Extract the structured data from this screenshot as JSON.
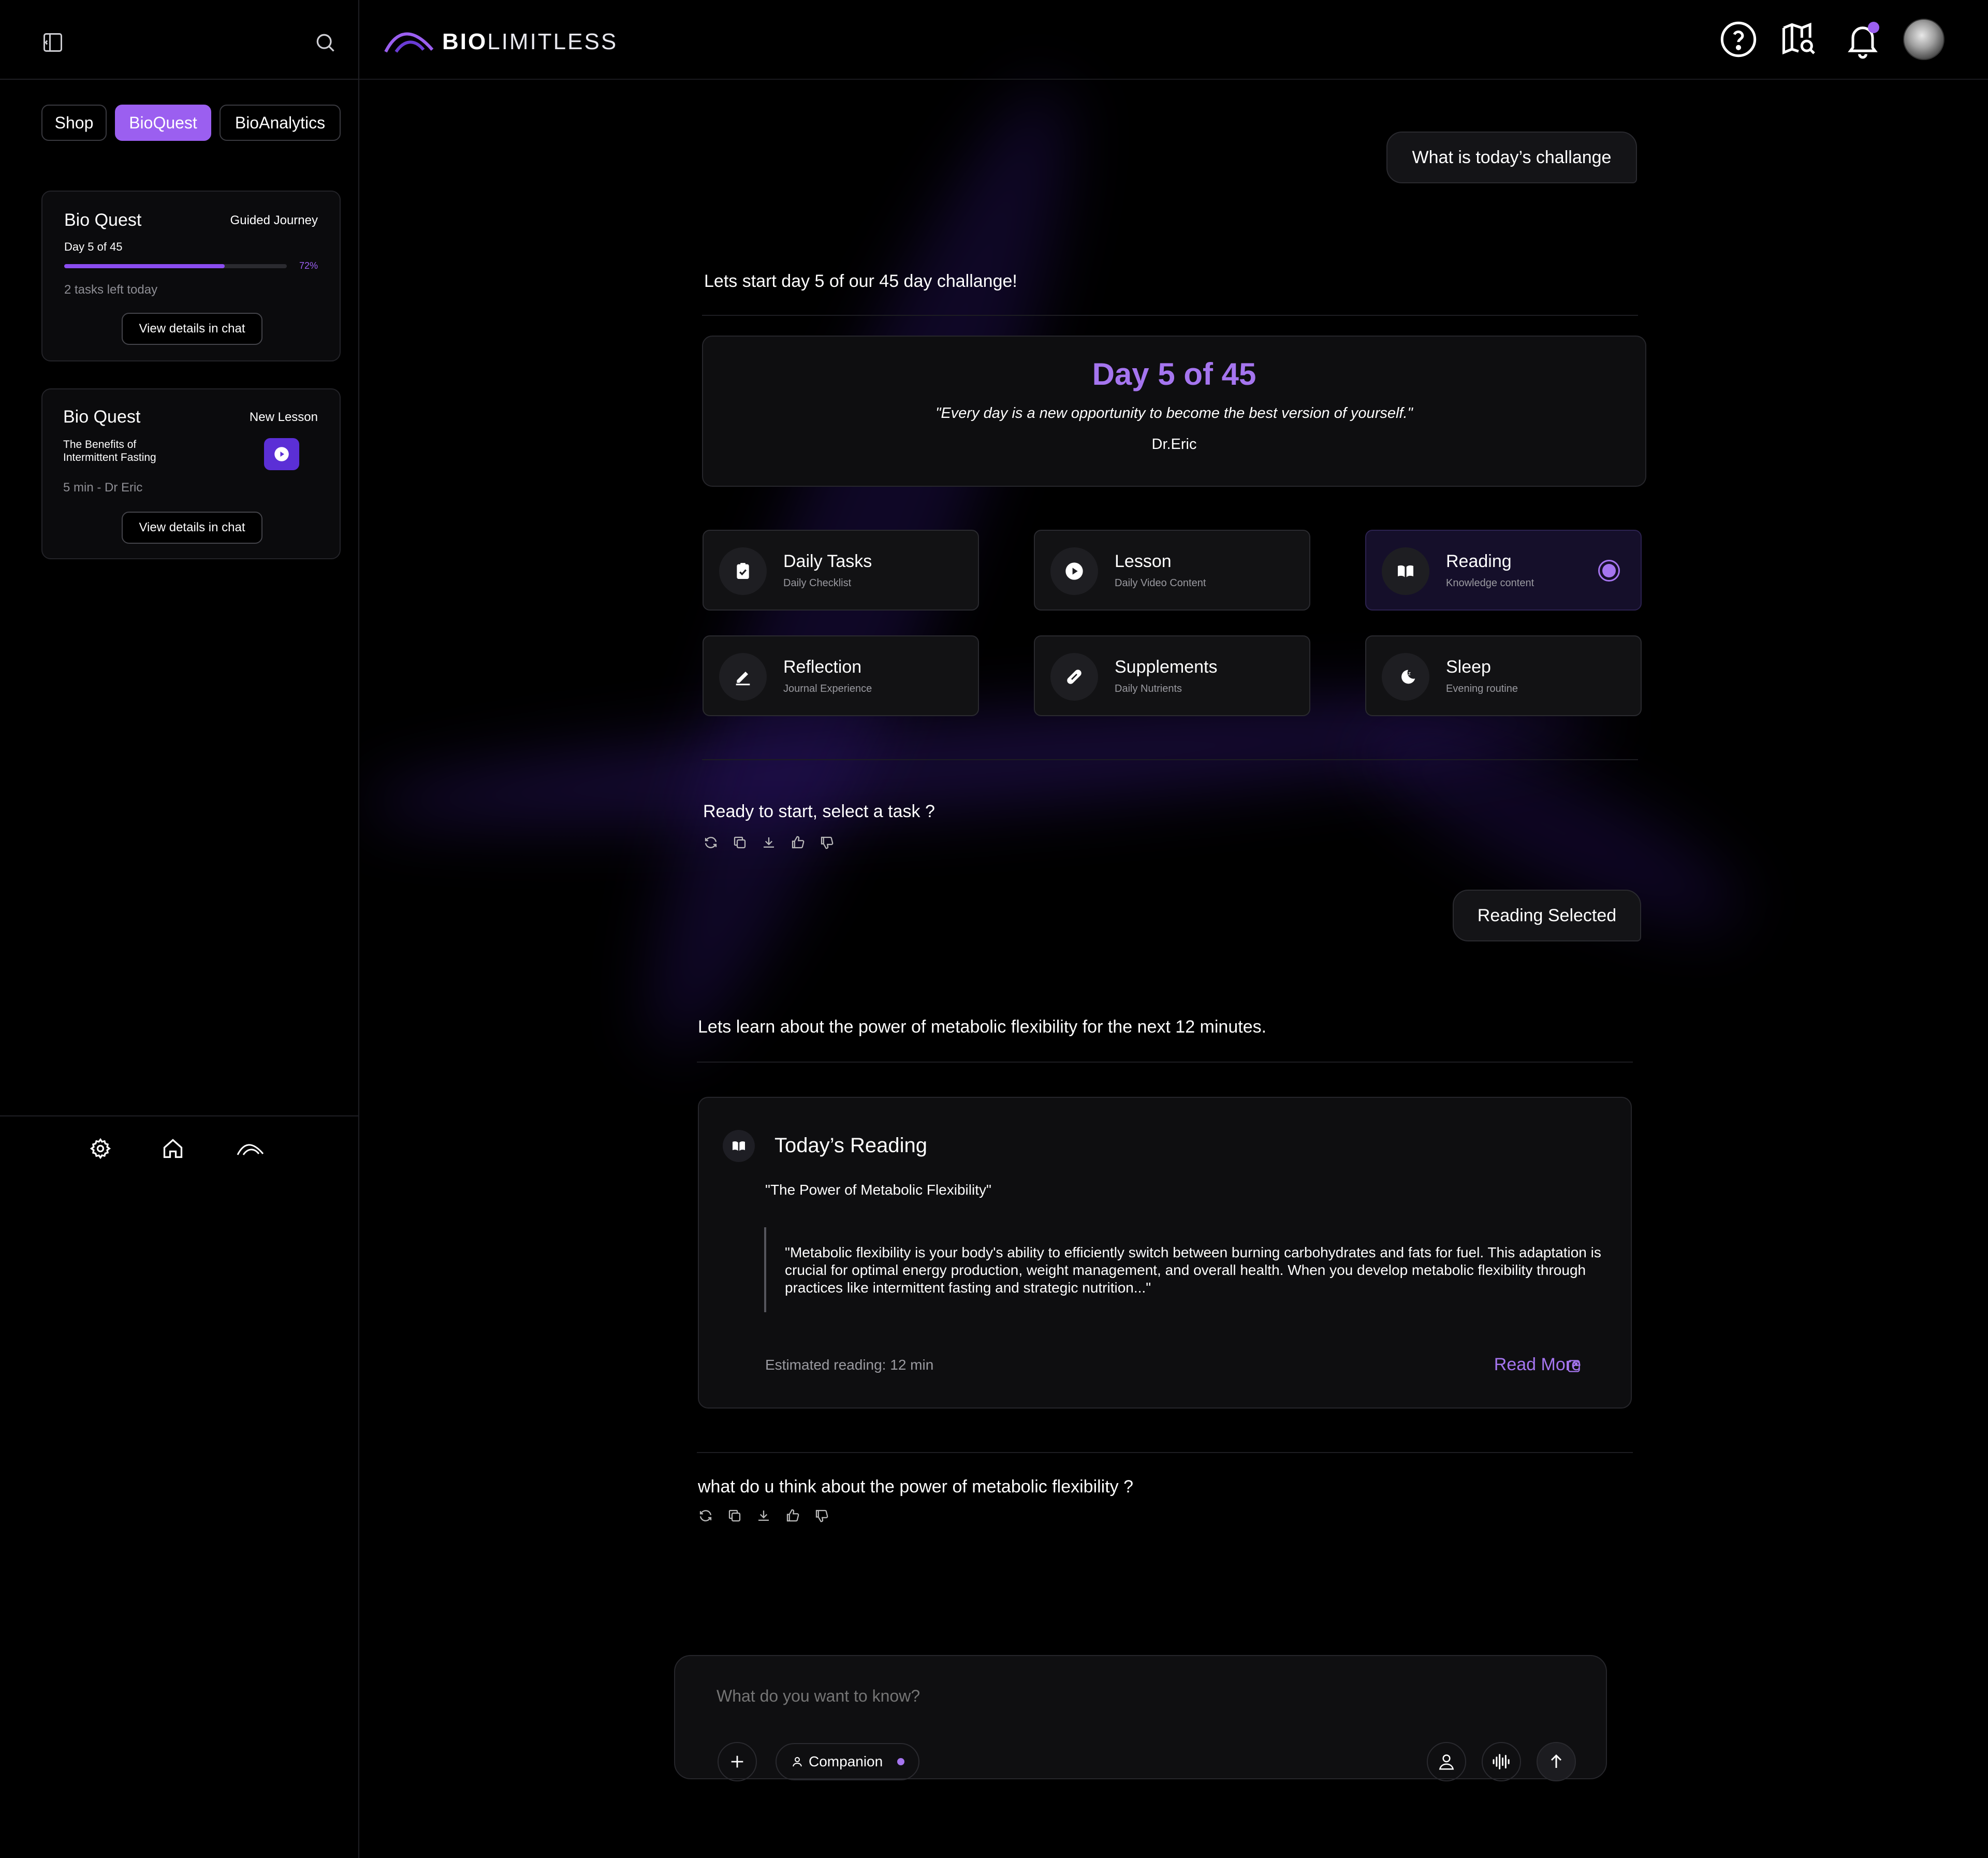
{
  "app": {
    "brand_bold": "BIO",
    "brand_light": "LIMITLESS",
    "brand_color": "#9b5ff0"
  },
  "sidebar": {
    "tabs": [
      {
        "label": "Shop",
        "active": false
      },
      {
        "label": "BioQuest",
        "active": true
      },
      {
        "label": "BioAnalytics",
        "active": false
      }
    ],
    "cards": [
      {
        "title": "Bio Quest",
        "tag": "Guided Journey",
        "subtitle": "Day 5 of 45",
        "progress": 0.72,
        "progress_label": "72%",
        "note": "2 tasks left today",
        "button": "View details in chat"
      },
      {
        "title": "Bio Quest",
        "tag": "New Lesson",
        "subtitle": "The Benefits of Intermittent Fasting",
        "note": "5 min - Dr Eric",
        "button": "View details in chat"
      }
    ]
  },
  "chat": {
    "user_msg_1": "What is today’s challange",
    "bot_msg_1": "Lets start day 5 of our 45 day challange!",
    "day_card": {
      "title": "Day 5 of 45",
      "quote": "\"Every day is a new opportunity to become the best version of yourself.\"",
      "author": "Dr.Eric"
    },
    "tasks": [
      {
        "title": "Daily Tasks",
        "sub": "Daily Checklist",
        "icon": "clipboard-check-icon",
        "selected": false
      },
      {
        "title": "Lesson",
        "sub": "Daily Video Content",
        "icon": "play-icon",
        "selected": false
      },
      {
        "title": "Reading",
        "sub": "Knowledge content",
        "icon": "book-icon",
        "selected": true
      },
      {
        "title": "Reflection",
        "sub": "Journal Experience",
        "icon": "pencil-icon",
        "selected": false
      },
      {
        "title": "Supplements",
        "sub": "Daily Nutrients",
        "icon": "pill-icon",
        "selected": false
      },
      {
        "title": "Sleep",
        "sub": "Evening routine",
        "icon": "moon-icon",
        "selected": false
      }
    ],
    "bot_msg_2": "Ready to start, select a task ?",
    "user_msg_2": "Reading Selected",
    "bot_msg_3": "Lets learn about the power of metabolic flexibility for the next 12 minutes.",
    "reading_card": {
      "title": "Today’s Reading",
      "subtitle": "\"The Power of Metabolic Flexibility\"",
      "excerpt": "\"Metabolic flexibility is your body's ability to efficiently switch between burning carbohydrates and fats for fuel. This adaptation is crucial for optimal energy production, weight management, and overall health. When you develop metabolic flexibility through practices like intermittent fasting and strategic nutrition...\"",
      "estimate": "Estimated reading: 12 min",
      "read_more": "Read More"
    },
    "bot_msg_4": "what do u think about the power of metabolic flexibility ?"
  },
  "input": {
    "placeholder": "What do you want to know?",
    "companion_label": "Companion"
  }
}
